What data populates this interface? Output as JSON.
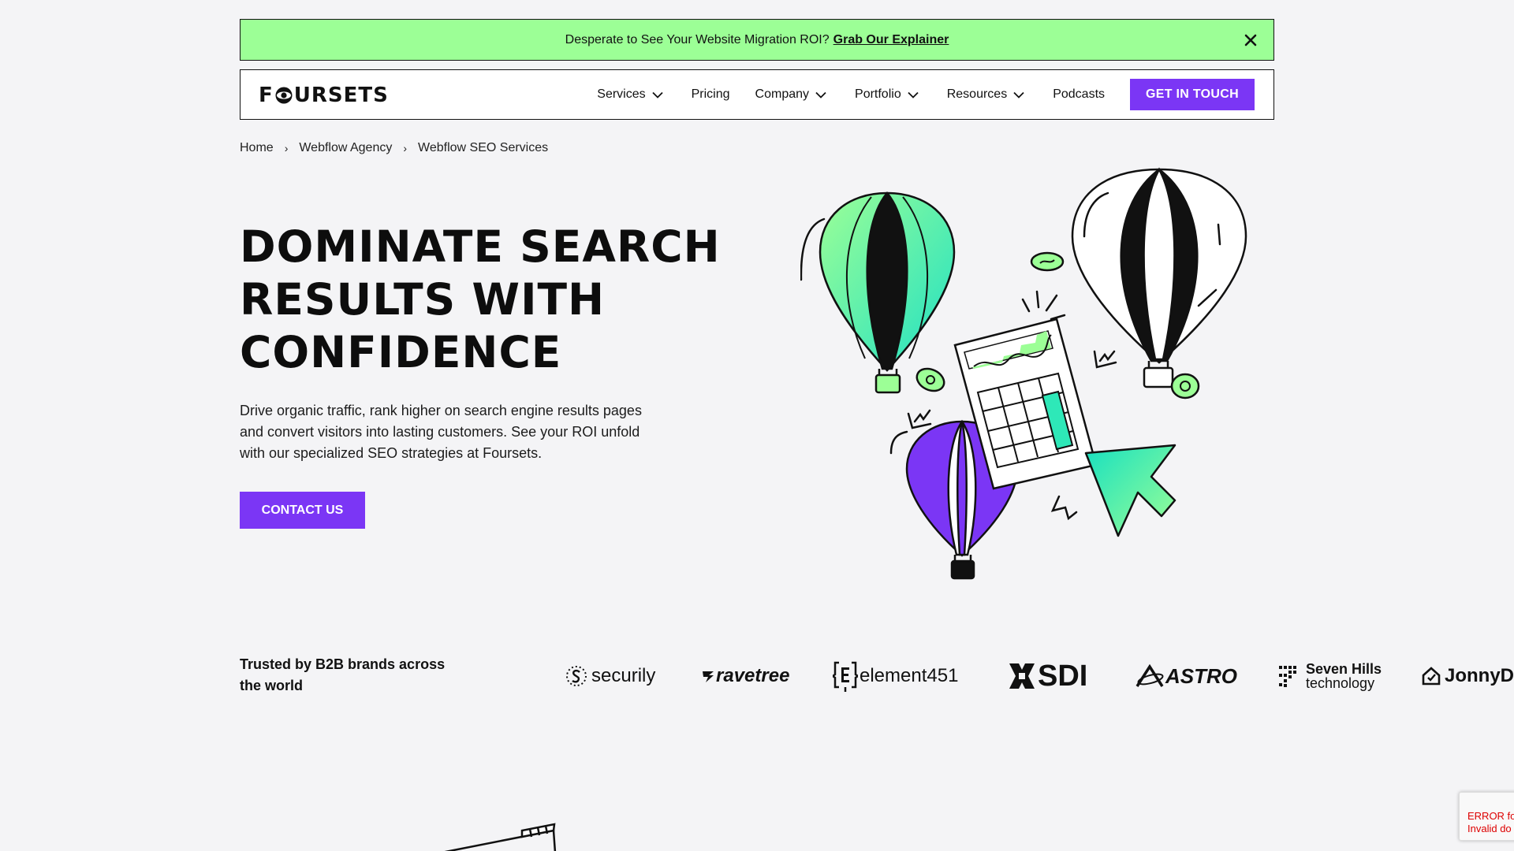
{
  "announcement": {
    "text": "Desperate to See Your Website Migration ROI?",
    "link": "Grab Our Explainer"
  },
  "nav": {
    "logo": {
      "text_before": "F",
      "text_after": "URSETS"
    },
    "items": [
      {
        "label": "Services",
        "dropdown": true
      },
      {
        "label": "Pricing",
        "dropdown": false
      },
      {
        "label": "Company",
        "dropdown": true
      },
      {
        "label": "Portfolio",
        "dropdown": true
      },
      {
        "label": "Resources",
        "dropdown": true
      },
      {
        "label": "Podcasts",
        "dropdown": false
      }
    ],
    "cta": "GET IN TOUCH"
  },
  "breadcrumb": [
    "Home",
    "Webflow Agency",
    "Webflow SEO Services"
  ],
  "hero": {
    "title_lines": [
      "DOMINATE SEARCH",
      "RESULTS WITH",
      "CONFIDENCE"
    ],
    "description": "Drive organic traffic, rank higher on search engine results pages and convert visitors into lasting customers. See your ROI unfold with our specialized SEO strategies at Foursets.",
    "button": "CONTACT US"
  },
  "trusted": {
    "label": "Trusted by B2B brands across the world",
    "brands": [
      {
        "name": "securily",
        "icon": "securily-logo-icon"
      },
      {
        "name": "ravetree",
        "icon": "ravetree-logo-icon"
      },
      {
        "name": "element451",
        "icon": "element451-logo-icon"
      },
      {
        "name": "SDI",
        "icon": "sdi-logo-icon"
      },
      {
        "name": "ASTRO",
        "icon": "astro-logo-icon"
      },
      {
        "name": "Seven Hills",
        "subname": "technology",
        "icon": "seven-hills-logo-icon"
      },
      {
        "name": "JonnyD",
        "icon": "jonnyd-logo-icon"
      }
    ]
  },
  "recaptcha": {
    "line1": "ERROR fo",
    "line2": "Invalid do"
  },
  "colors": {
    "accent_purple": "#7b36f5",
    "announce_green": "#9cff96",
    "teal": "#2ee8b8",
    "background": "#f4f4f6"
  }
}
